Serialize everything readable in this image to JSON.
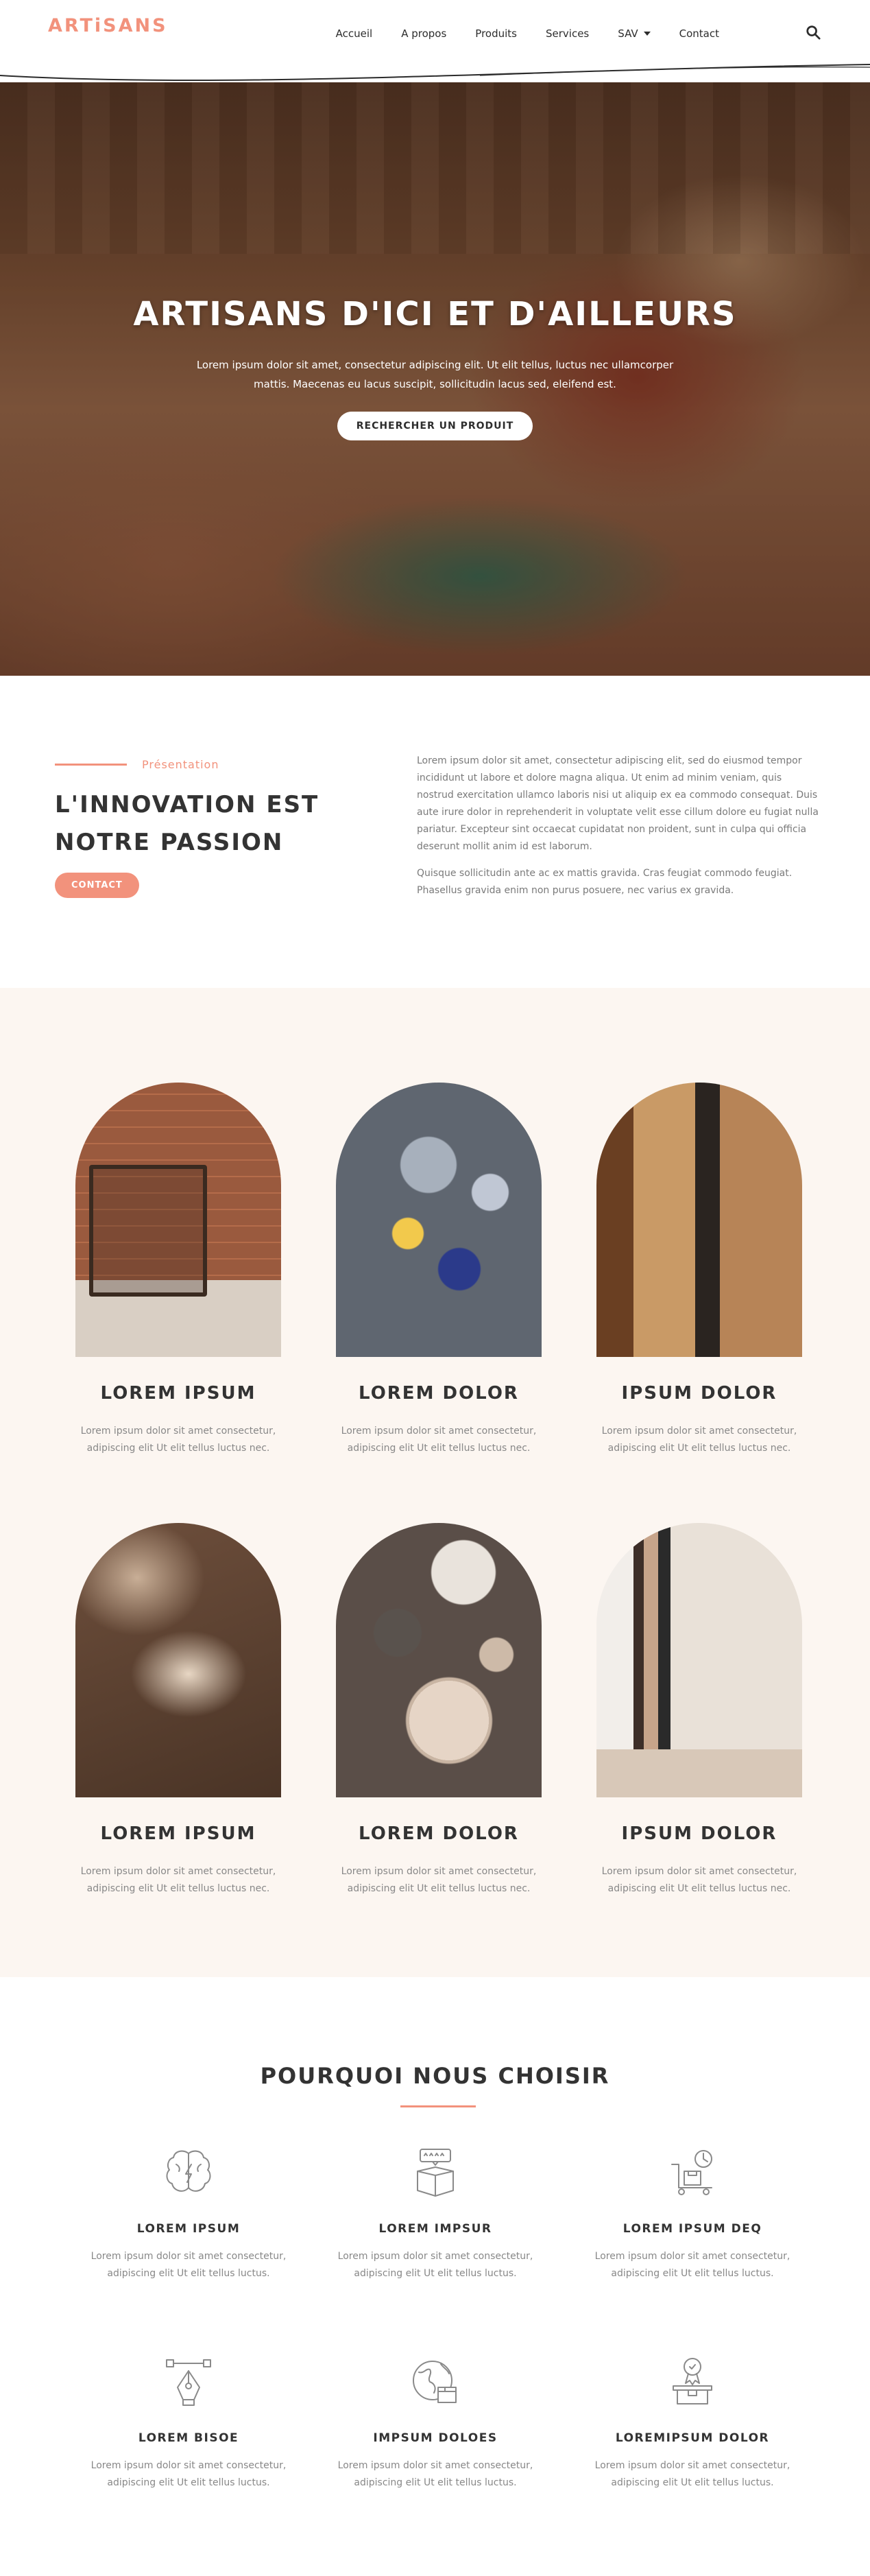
{
  "brand": {
    "logo": "ARTiSANS",
    "accent": "#f2927c"
  },
  "nav": {
    "items": [
      "Accueil",
      "A propos",
      "Produits",
      "Services",
      "SAV",
      "Contact"
    ]
  },
  "hero": {
    "title": "ARTISANS D'ICI ET D'AILLEURS",
    "text": "Lorem ipsum dolor sit amet, consectetur adipiscing elit. Ut elit tellus, luctus nec ullamcorper mattis. Maecenas eu lacus suscipit, sollicitudin lacus sed, eleifend est.",
    "button": "RECHERCHER UN PRODUIT"
  },
  "presentation": {
    "kicker": "Présentation",
    "title": "L'INNOVATION EST NOTRE PASSION",
    "button": "CONTACT",
    "paragraph1": "Lorem ipsum dolor sit amet, consectetur adipiscing elit, sed do eiusmod tempor incididunt ut labore et dolore magna aliqua. Ut enim ad minim veniam, quis nostrud exercitation ullamco laboris nisi ut aliquip ex ea commodo consequat. Duis aute irure dolor in reprehenderit in voluptate velit esse cillum dolore eu fugiat nulla pariatur. Excepteur sint occaecat cupidatat non proident, sunt in culpa qui officia deserunt mollit anim id est laborum.",
    "paragraph2": "Quisque sollicitudin ante ac ex mattis gravida. Cras feugiat commodo feugiat. Phasellus gravida enim non purus posuere, nec varius ex gravida."
  },
  "cards": [
    {
      "title": "LOREM IPSUM",
      "text": "Lorem ipsum dolor sit amet consectetur, adipiscing elit Ut elit tellus luctus nec."
    },
    {
      "title": "LOREM DOLOR",
      "text": "Lorem ipsum dolor sit amet consectetur, adipiscing elit Ut elit tellus luctus nec."
    },
    {
      "title": "IPSUM DOLOR",
      "text": "Lorem ipsum dolor sit amet consectetur, adipiscing elit Ut elit tellus luctus nec."
    },
    {
      "title": "LOREM IPSUM",
      "text": "Lorem ipsum dolor sit amet consectetur, adipiscing elit Ut elit tellus luctus nec."
    },
    {
      "title": "LOREM DOLOR",
      "text": "Lorem ipsum dolor sit amet consectetur, adipiscing elit Ut elit tellus luctus nec."
    },
    {
      "title": "IPSUM DOLOR",
      "text": "Lorem ipsum dolor sit amet consectetur, adipiscing elit Ut elit tellus luctus nec."
    }
  ],
  "why": {
    "title": "POURQUOI NOUS CHOISIR",
    "features": [
      {
        "icon": "brain-icon",
        "title": "LOREM IPSUM",
        "text": "Lorem ipsum dolor sit amet consectetur, adipiscing elit Ut elit tellus luctus."
      },
      {
        "icon": "rating-box-icon",
        "title": "LOREM IMPSUR",
        "text": "Lorem ipsum dolor sit amet consectetur, adipiscing elit Ut elit tellus luctus."
      },
      {
        "icon": "delivery-cart-icon",
        "title": "LOREM IPSUM DEQ",
        "text": "Lorem ipsum dolor sit amet consectetur, adipiscing elit Ut elit tellus luctus."
      },
      {
        "icon": "pen-tool-icon",
        "title": "LOREM BISOE",
        "text": "Lorem ipsum dolor sit amet consectetur, adipiscing elit Ut elit tellus luctus."
      },
      {
        "icon": "globe-package-icon",
        "title": "IMPSUM DOLOES",
        "text": "Lorem ipsum dolor sit amet consectetur, adipiscing elit Ut elit tellus luctus."
      },
      {
        "icon": "award-box-icon",
        "title": "LOREMIPSUM DOLOR",
        "text": "Lorem ipsum dolor sit amet consectetur, adipiscing elit Ut elit tellus luctus."
      }
    ]
  }
}
